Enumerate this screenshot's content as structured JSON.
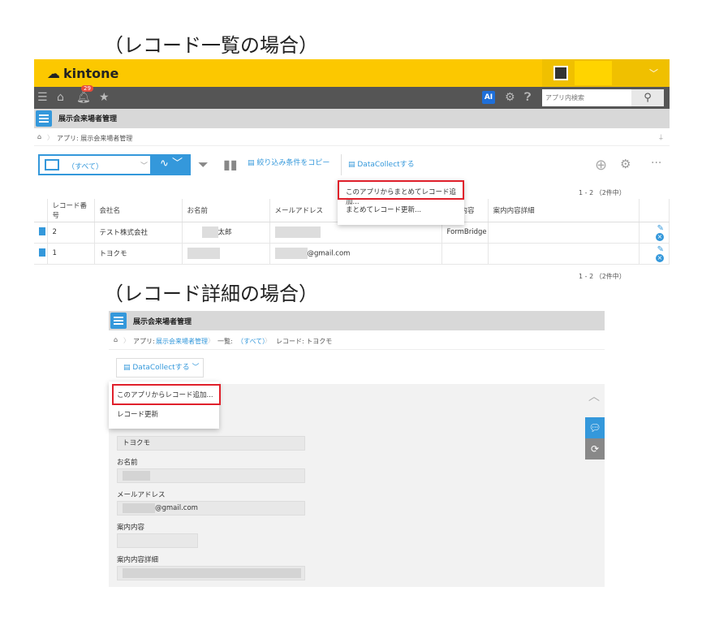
{
  "headings": {
    "list": "（レコード一覧の場合）",
    "detail": "（レコード詳細の場合）"
  },
  "top_bar": {
    "logo_text": "kintone",
    "user_menu_chevron": "﹀"
  },
  "nav": {
    "notification_count": "29",
    "ai_label": "AI",
    "search_placeholder": "アプリ内検索"
  },
  "app": {
    "title": "展示会来場者管理"
  },
  "list_view": {
    "breadcrumb": "アプリ: 展示会来場者管理",
    "view_select_label": "（すべて）",
    "copy_filter_label": "絞り込み条件をコピー",
    "datacollect_label": "DataCollectする",
    "pagination": "1 - 2 （2件中）",
    "dropdown_items": [
      "このアプリからまとめてレコード追加...",
      "まとめてレコード更新..."
    ],
    "columns": [
      "",
      "レコード番号",
      "会社名",
      "お名前",
      "メールアドレス",
      "案内内容",
      "案内内容詳細",
      ""
    ],
    "rows": [
      {
        "no": "2",
        "company": "テスト株式会社",
        "name_suffix": "太郎",
        "email_suffix": "",
        "guide": "FormBridge"
      },
      {
        "no": "1",
        "company": "トヨクモ",
        "name_suffix": "",
        "email_suffix": "@gmail.com",
        "guide": ""
      }
    ]
  },
  "detail_view": {
    "breadcrumb_app_prefix": "アプリ: ",
    "breadcrumb_app": "展示会来場者管理",
    "breadcrumb_list_prefix": "一覧: ",
    "breadcrumb_list": "（すべて）",
    "breadcrumb_record": "レコード: トヨクモ",
    "datacollect_label": "DataCollectする",
    "dropdown_items": [
      "このアプリからレコード追加...",
      "レコード更新"
    ],
    "fields": {
      "company_value": "トヨクモ",
      "name_label": "お名前",
      "email_label": "メールアドレス",
      "email_suffix": "@gmail.com",
      "guide_label": "案内内容",
      "guide_detail_label": "案内内容詳細"
    }
  },
  "colors": {
    "kintone_yellow": "#fcc800",
    "accent_blue": "#3498db",
    "highlight_red": "#e0202b"
  }
}
